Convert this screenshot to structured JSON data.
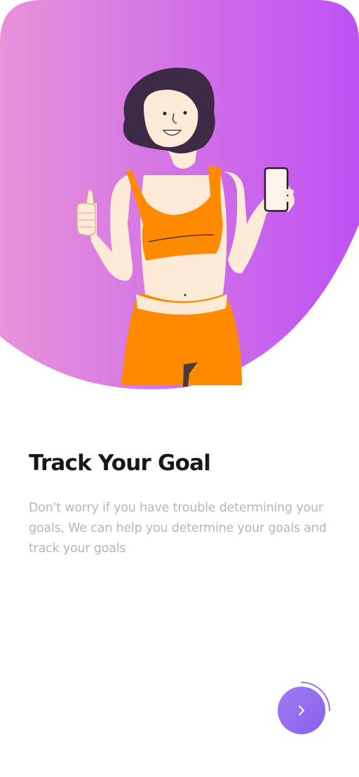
{
  "onboarding": {
    "title": "Track Your Goal",
    "description": "Don't worry if you have trouble determining your goals, We can help you determine your goals and track your goals",
    "progress": 0.25
  },
  "next_button": {
    "icon": "chevron-right-icon"
  },
  "colors": {
    "gradient_start": "#e892d9",
    "gradient_end": "#bd52f4",
    "button_start": "#a07bf0",
    "button_end": "#8a5ff0",
    "title": "#1d1617",
    "body_text": "#b6b4c2",
    "outfit": "#ff8a00"
  }
}
